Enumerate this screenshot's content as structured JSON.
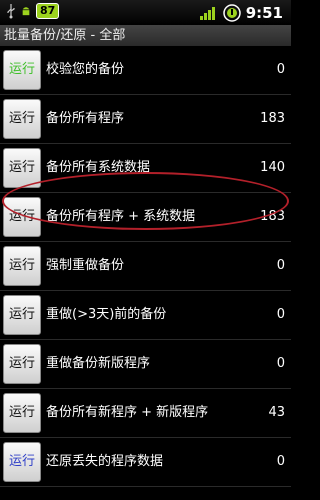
{
  "status_bar": {
    "battery": "87",
    "time": "9:51",
    "icons": [
      "usb-icon",
      "android-icon",
      "battery-icon",
      "signal-icon",
      "circle-dial-icon"
    ]
  },
  "title": "批量备份/还原 - 全部",
  "colors": {
    "run_green": "#3fbf2a",
    "run_blue": "#2f3fc8",
    "run_default": "#111111",
    "highlight": "#b3202a"
  },
  "rows": [
    {
      "button": "运行",
      "label": "校验您的备份",
      "count": "0",
      "button_color": "green"
    },
    {
      "button": "运行",
      "label": "备份所有程序",
      "count": "183",
      "button_color": "default"
    },
    {
      "button": "运行",
      "label": "备份所有系统数据",
      "count": "140",
      "button_color": "default"
    },
    {
      "button": "运行",
      "label": "备份所有程序 + 系统数据",
      "count": "183",
      "button_color": "default"
    },
    {
      "button": "运行",
      "label": "强制重做备份",
      "count": "0",
      "button_color": "default"
    },
    {
      "button": "运行",
      "label": "重做(>3天)前的备份",
      "count": "0",
      "button_color": "default"
    },
    {
      "button": "运行",
      "label": "重做备份新版程序",
      "count": "0",
      "button_color": "default"
    },
    {
      "button": "运行",
      "label": "备份所有新程序 + 新版程序",
      "count": "43",
      "button_color": "default"
    },
    {
      "button": "运行",
      "label": "还原丢失的程序数据",
      "count": "0",
      "button_color": "blue"
    }
  ]
}
